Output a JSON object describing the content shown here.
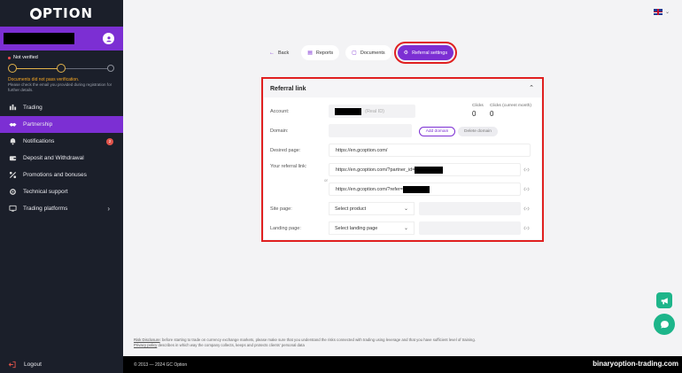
{
  "brand": {
    "logo_text": "PTION"
  },
  "user": {
    "status": "Not verified"
  },
  "verification": {
    "warning_title": "Documents did not pass verification.",
    "warning_text": "Please check the email you provided during registration for further details."
  },
  "sidebar": {
    "items": [
      {
        "label": "Trading",
        "icon": "candles-icon"
      },
      {
        "label": "Partnership",
        "icon": "handshake-icon"
      },
      {
        "label": "Notifications",
        "icon": "bell-icon",
        "badge": "2"
      },
      {
        "label": "Deposit and Withdrawal",
        "icon": "wallet-icon"
      },
      {
        "label": "Promotions and bonuses",
        "icon": "percent-icon"
      },
      {
        "label": "Technical support",
        "icon": "gear-icon"
      },
      {
        "label": "Trading platforms",
        "icon": "monitor-icon"
      }
    ],
    "logout": "Logout"
  },
  "tabs": {
    "back": "Back",
    "reports": "Reports",
    "documents": "Documents",
    "referral_settings": "Referral settings"
  },
  "panel": {
    "title": "Referral link",
    "account_label": "Account:",
    "account_suffix": "(Real ID)",
    "clicks_label": "Clicks",
    "clicks_value": "0",
    "clicks_month_label": "Clicks (current month)",
    "clicks_month_value": "0",
    "domain_label": "Domain:",
    "add_domain": "Add domain",
    "delete_domain": "Delete domain",
    "desired_page_label": "Desired page:",
    "desired_page_value": "https://en.gcoption.com/",
    "referral_link_label": "Your referral link:",
    "referral_link_1": "https://en.gcoption.com/?partner_id=",
    "or": "or",
    "referral_link_2": "https://en.gcoption.com/?refer=",
    "site_page_label": "Site page:",
    "site_page_select": "Select product",
    "landing_page_label": "Landing page:",
    "landing_page_select": "Select landing page"
  },
  "footer": {
    "risk_link": "Risk Disclosure",
    "risk_text": ": before starting to trade on currency exchange markets, please make sure that you understand the risks connected with trading using leverage and that you have sufficient level of training.",
    "privacy_link": "Privacy policy",
    "privacy_text": " describes in which way the company collects, keeps and protects clients' personal data",
    "copyright": "© 2013 — 2024 GC Option"
  },
  "watermark": "binaryoption-trading.com",
  "colors": {
    "accent": "#7c2fd3",
    "sidebar_bg": "#1b1f2a",
    "highlight": "#e02020",
    "fab": "#1db58a"
  }
}
